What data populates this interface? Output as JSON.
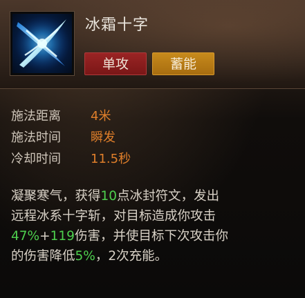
{
  "skill": {
    "name": "冰霜十字",
    "icon": "ice-cross-slash-icon",
    "tags": [
      {
        "label": "单攻",
        "color": "#8b1e1e"
      },
      {
        "label": "蓄能",
        "color": "#b87a14"
      }
    ]
  },
  "stats": [
    {
      "label": "施法距离",
      "value": "4米"
    },
    {
      "label": "施法时间",
      "value": "瞬发"
    },
    {
      "label": "冷却时间",
      "value": "11.5秒"
    }
  ],
  "description": {
    "line1": {
      "a": "凝聚寒气，获得",
      "b": "10",
      "c": "点冰封符文，发出"
    },
    "line2": "远程冰系十字斩，对目标造成你攻击",
    "line3": {
      "a": "47%",
      "b": "+",
      "c": "119",
      "d": "伤害，并使目标下次攻击你"
    },
    "line4": {
      "a": "的伤害降低",
      "b": "5%",
      "c": "，2次充能。"
    }
  },
  "colors": {
    "value_orange": "#e07f2a",
    "highlight_green": "#4ed04e",
    "text": "#d8d1c6"
  }
}
